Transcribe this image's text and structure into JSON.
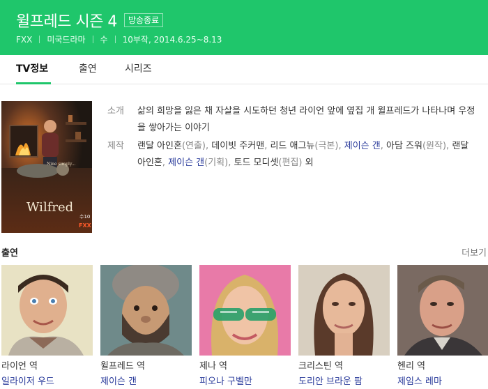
{
  "header": {
    "title": "윌프레드 시즌 4",
    "status_badge": "방송종료",
    "meta": [
      "FXX",
      "미국드라마",
      "수",
      "10부작, 2014.6.25~8.13"
    ]
  },
  "tabs": [
    {
      "label": "TV정보",
      "active": true
    },
    {
      "label": "출연",
      "active": false
    },
    {
      "label": "시리즈",
      "active": false
    }
  ],
  "poster": {
    "title": "Wilfred",
    "small_text": "Nine simply...",
    "badge": "수10",
    "network": "FXX"
  },
  "info": {
    "intro_label": "소개",
    "intro_text": "삶의 희망을 잃은 채 자살을 시도하던 청년 라이언 앞에 옆집 개 윌프레드가 나타나며 우정을 쌓아가는 이야기",
    "production_label": "제작",
    "production": [
      {
        "name": "랜달 아인혼",
        "role": "(연출), "
      },
      {
        "name": "데이빗 주커맨",
        "role": ", "
      },
      {
        "name": "리드 애그뉴",
        "role": "(극본), "
      },
      {
        "name": "제이슨 갠",
        "role": ", ",
        "link": true
      },
      {
        "name": "아담 즈워",
        "role": "(원작), "
      },
      {
        "name": "랜달 아인혼",
        "role": ", "
      },
      {
        "name": "제이슨 갠",
        "role": "(기획), ",
        "link": true
      },
      {
        "name": "토드 모디셋",
        "role": "(편집) "
      },
      {
        "name": "외",
        "role": ""
      }
    ]
  },
  "cast": {
    "title": "출연",
    "more": "더보기",
    "members": [
      {
        "role": "라이언 역",
        "actor": "일라이저 우드"
      },
      {
        "role": "윌프레드 역",
        "actor": "제이슨 갠"
      },
      {
        "role": "제나 역",
        "actor": "피오나 구벨만"
      },
      {
        "role": "크리스틴 역",
        "actor": "도리안 브라운 팜"
      },
      {
        "role": "헨리 역",
        "actor": "제임스 레마"
      }
    ]
  },
  "colors": {
    "brand_green": "#1fc66b",
    "link_blue": "#2a3b9b"
  }
}
